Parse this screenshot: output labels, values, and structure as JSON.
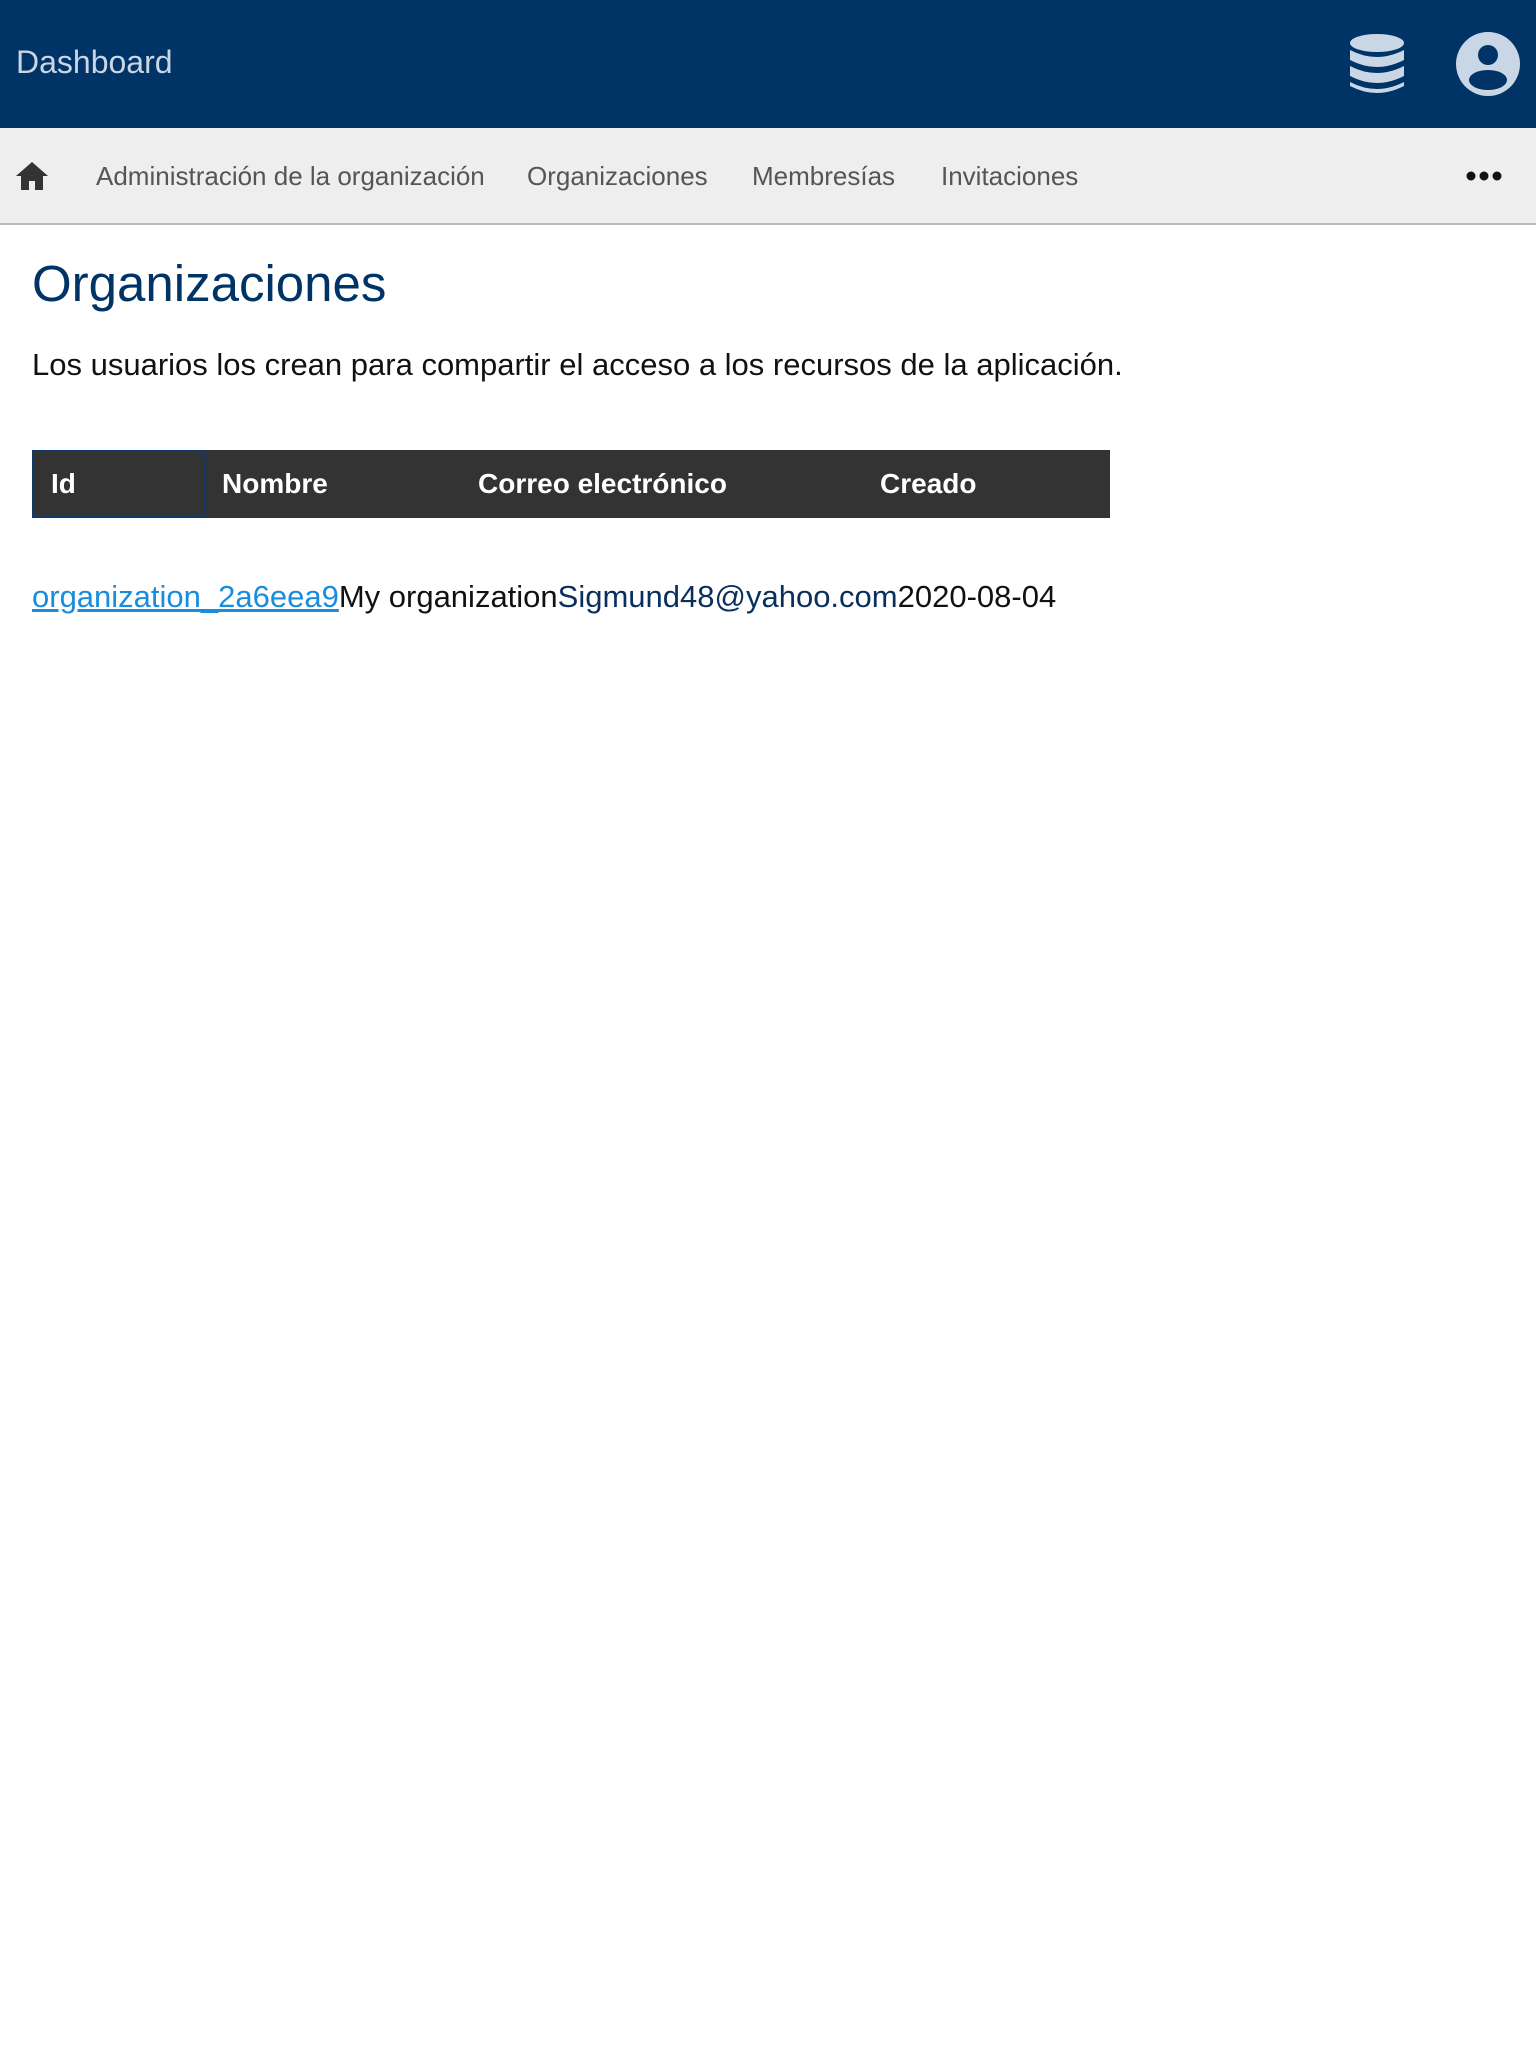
{
  "header": {
    "brand": "Dashboard",
    "icons": {
      "database": "database-icon",
      "account": "account-circle-icon"
    },
    "colors": {
      "background": "#003366",
      "icon": "#c9d6e6"
    }
  },
  "subnav": {
    "home_icon": "home-icon",
    "items": [
      {
        "label": "Administración de la organización"
      },
      {
        "label": "Organizaciones"
      },
      {
        "label": "Membresías"
      },
      {
        "label": "Invitaciones"
      }
    ],
    "more_icon": "more-horizontal-icon"
  },
  "main": {
    "title": "Organizaciones",
    "description": "Los usuarios los crean para compartir el acceso a los recursos de la aplicación."
  },
  "table": {
    "columns": [
      "Id",
      "Nombre",
      "Correo electrónico",
      "Creado"
    ],
    "rows": [
      {
        "id": "organization_2a6eea9",
        "name": "My organization",
        "email": "Sigmund48@yahoo.com",
        "created": "2020-08-04"
      }
    ]
  },
  "colors": {
    "accent": "#003366",
    "link": "#1a8cde",
    "table_header": "#333333",
    "nav_background": "#eeeeee"
  }
}
